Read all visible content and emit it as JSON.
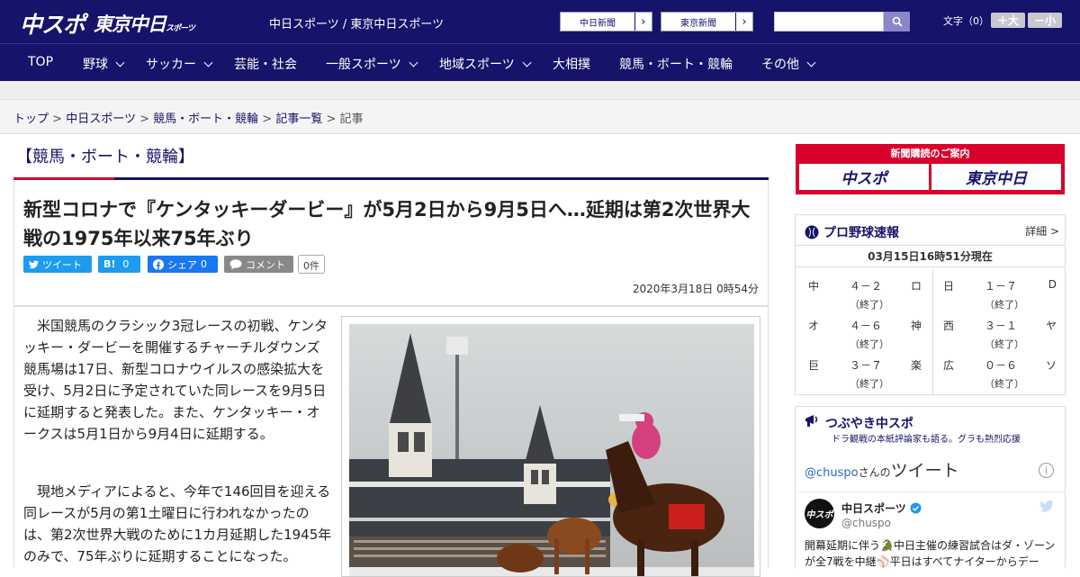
{
  "header": {
    "logo_chu": "中スポ",
    "logo_tokyo": "東京中日",
    "logo_tokyo_small": "スポーツ",
    "site_title": "中日スポーツ / 東京中日スポーツ",
    "news_btn_1": "中日新聞",
    "news_btn_2": "東京新聞",
    "arrow": "›",
    "font_label": "文字（0）",
    "font_plus": "＋大",
    "font_minus": "－小"
  },
  "nav": {
    "items": [
      "TOP",
      "野球",
      "サッカー",
      "芸能・社会",
      "一般スポーツ",
      "地域スポーツ",
      "大相撲",
      "競馬・ボート・競輪",
      "その他"
    ]
  },
  "breadcrumb": {
    "items": [
      "トップ",
      "中日スポーツ",
      "競馬・ボート・競輪",
      "記事一覧"
    ],
    "current": "記事",
    "sep": ">"
  },
  "article": {
    "section": "【競馬・ボート・競輪】",
    "headline": "新型コロナで『ケンタッキーダービー』が5月2日から9月5日へ…延期は第2次世界大戦の1975年以来75年ぶり",
    "share": {
      "tweet": "ツイート",
      "hatena_b": "B!",
      "hatena_count": "0",
      "facebook": "シェア",
      "facebook_count": "0",
      "comment": "コメント",
      "comment_count": "0件"
    },
    "date": "2020年3月18日 0時54分",
    "para1": "米国競馬のクラシック3冠レースの初戦、ケンタッキー・ダービーを開催するチャーチルダウンズ競馬場は17日、新型コロナウイルスの感染拡大を受け、5月2日に予定されていた同レースを9月5日に延期すると発表した。また、ケンタッキー・オークスは5月1日から9月4日に延期する。",
    "para2": "現地メディアによると、今年で146回目を迎える同レースが5月の第1土曜日に行われなかったのは、第2次世界大戦のために1カ月延期した1945年のみで、75年ぶりに延期することになった。"
  },
  "sidebar": {
    "subscribe_title": "新聞購読のご案内",
    "subscribe_chu": "中スポ",
    "subscribe_tokyo": "東京中日",
    "baseball_title": "プロ野球速報",
    "baseball_more": "詳細 >",
    "baseball_time": "03月15日16時51分現在",
    "games": [
      {
        "t1": "中",
        "score": "４－２",
        "t2": "ロ",
        "status": "（終了）"
      },
      {
        "t1": "日",
        "score": "１－７",
        "t2": "D",
        "status": "（終了）"
      },
      {
        "t1": "オ",
        "score": "４－６",
        "t2": "神",
        "status": "（終了）"
      },
      {
        "t1": "西",
        "score": "３－１",
        "t2": "ヤ",
        "status": "（終了）"
      },
      {
        "t1": "巨",
        "score": "３－７",
        "t2": "楽",
        "status": "（終了）"
      },
      {
        "t1": "広",
        "score": "０－６",
        "t2": "ソ",
        "status": "（終了）"
      }
    ],
    "tw_head": "つぶやき中スポ",
    "tw_sub": "ドラ観戦の本紙評論家も語る。グラも熱烈応援",
    "tw_handle_link": "@chuspo",
    "tw_san": "さんの",
    "tw_title": "ツイート",
    "tw_info": "i",
    "tw_avatar": "中スポ",
    "tw_name": "中日スポーツ",
    "tw_handle": "@chuspo",
    "tw_text": "開幕延期に伴う🐊中日主催の練習試合はダ・ゾーンが全7戦を中継⚾平日はすべてナイターからデー"
  },
  "colors": {
    "brand": "#15136a",
    "accent": "#d8002c",
    "twitter": "#1d9bf0",
    "facebook": "#1877f2"
  }
}
